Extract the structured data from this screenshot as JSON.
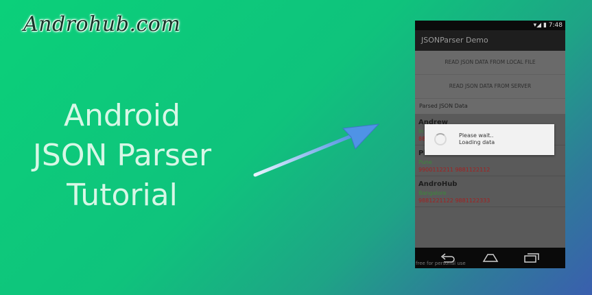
{
  "logo": {
    "text": "Androhub.com"
  },
  "hero": {
    "line1": "Android",
    "line2": "JSON Parser",
    "line3": "Tutorial"
  },
  "phone": {
    "status_time": "7:48",
    "app_title": "JSONParser Demo",
    "buttons": [
      {
        "label": "READ JSON DATA FROM LOCAL FILE"
      },
      {
        "label": "READ JSON DATA FROM SERVER"
      }
    ],
    "section_header": "Parsed JSON Data",
    "items": [
      {
        "name": "Andrew",
        "city": "In",
        "phone": "88"
      },
      {
        "name": "Pi",
        "city": "Pune",
        "phone": "9900112211  9881122112"
      },
      {
        "name": "AndroHub",
        "city": "Bangalore",
        "phone": "9881221122  9881122333"
      }
    ],
    "dialog": {
      "line1": "Please wait..",
      "line2": "Loading data"
    },
    "watermark": "free for personal use"
  },
  "colors": {
    "background_start": "#0bd07a",
    "background_end": "#3a5fae",
    "hero_text": "#d7f7e6",
    "city_text": "#3a8a3a",
    "phone_text": "#a32020"
  }
}
